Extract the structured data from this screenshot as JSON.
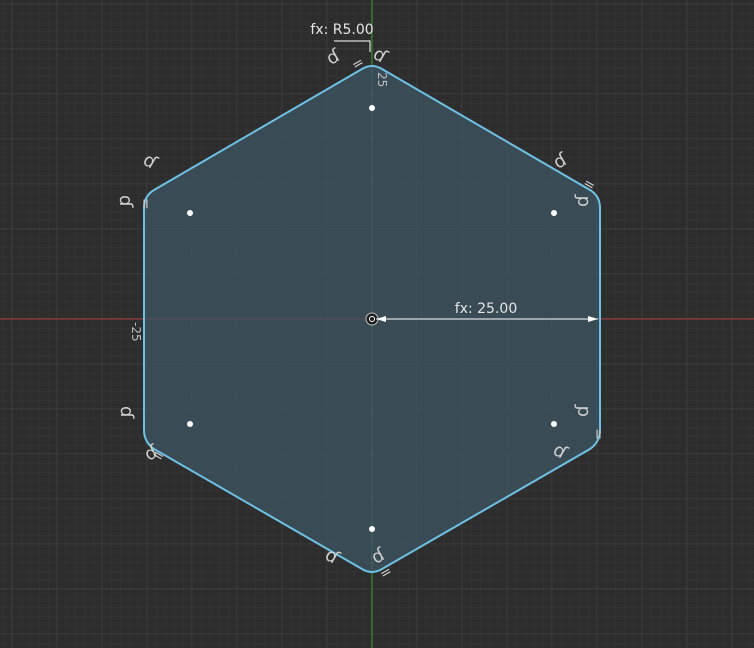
{
  "sketch": {
    "colors": {
      "background": "#2d2d2d",
      "grid_minor": "#363636",
      "grid_major": "#424242",
      "x_axis": "#b03a3a",
      "y_axis": "#2f9a3a",
      "profile_stroke": "#6ec1e4",
      "profile_fill": "#3e5563",
      "dimension": "#ffffff",
      "points": "#ffffff"
    },
    "radius_dimension_label": "fx: R5.00",
    "linear_dimension_label": "fx: 25.00",
    "axis_label_top": "25",
    "axis_label_left": "-25",
    "constraint_icons": {
      "tangent": "tangent-constraint-icon",
      "equal": "equal-constraint-icon"
    },
    "tangent_glyph": "ɗ",
    "equal_glyph": "="
  }
}
